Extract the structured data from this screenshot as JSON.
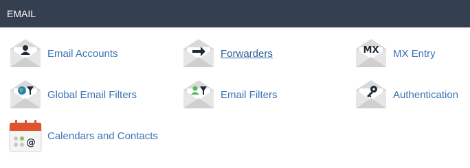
{
  "section": {
    "title": "EMAIL"
  },
  "items": [
    {
      "label": "Email Accounts",
      "icon": "email-accounts-icon"
    },
    {
      "label": "Forwarders",
      "icon": "forwarders-icon"
    },
    {
      "label": "MX Entry",
      "icon": "mx-entry-icon",
      "icon_text": "MX"
    },
    {
      "label": "Global Email Filters",
      "icon": "global-email-filters-icon"
    },
    {
      "label": "Email Filters",
      "icon": "email-filters-icon"
    },
    {
      "label": "Authentication",
      "icon": "authentication-icon"
    },
    {
      "label": "Calendars and Contacts",
      "icon": "calendars-contacts-icon"
    }
  ],
  "colors": {
    "header_bg": "#34404f",
    "link": "#3a73b4",
    "envelope": "#d8d8d8",
    "calendar_red": "#e0532f"
  }
}
